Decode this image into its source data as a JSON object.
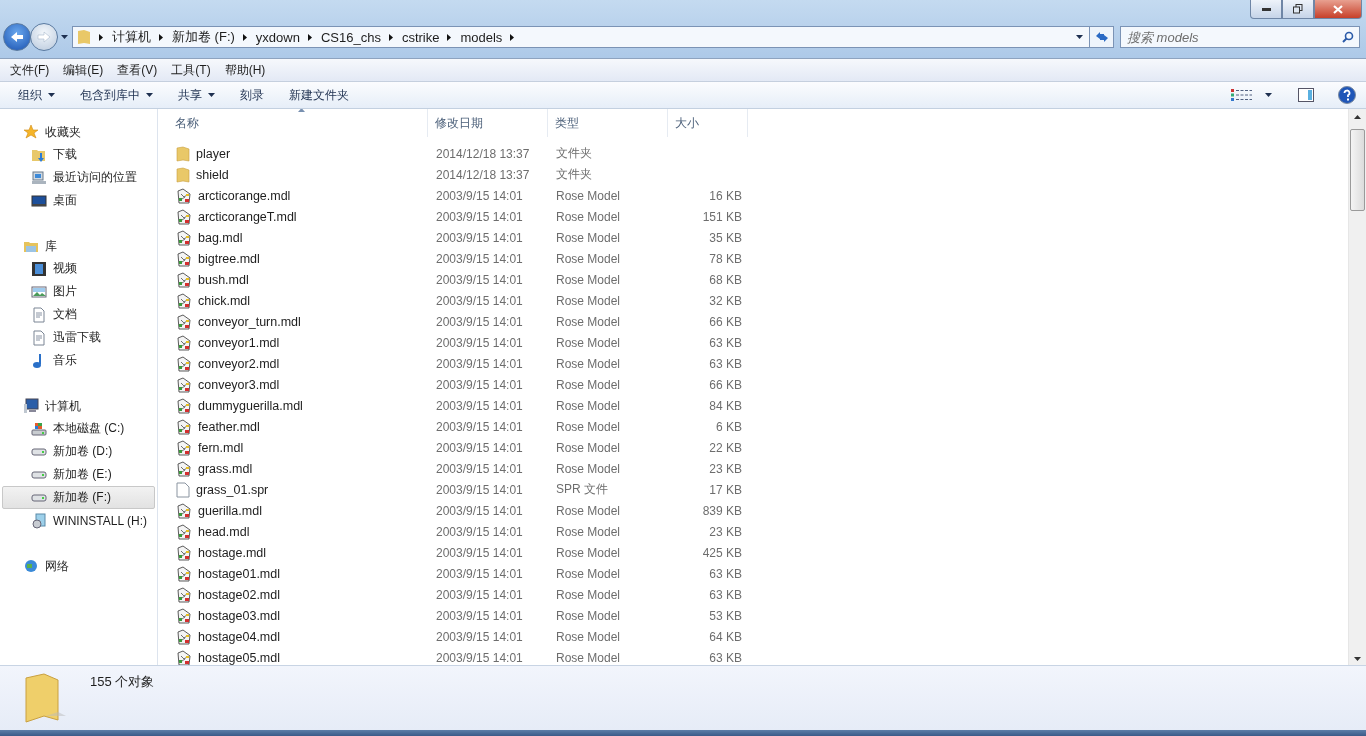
{
  "address": {
    "crumbs": [
      "计算机",
      "新加卷 (F:)",
      "yxdown",
      "CS16_chs",
      "cstrike",
      "models"
    ]
  },
  "search": {
    "placeholder": "搜索 models"
  },
  "menu": [
    "文件(F)",
    "编辑(E)",
    "查看(V)",
    "工具(T)",
    "帮助(H)"
  ],
  "toolbar": [
    {
      "label": "组织",
      "has_menu": true
    },
    {
      "label": "包含到库中",
      "has_menu": true
    },
    {
      "label": "共享",
      "has_menu": true
    },
    {
      "label": "刻录",
      "has_menu": false
    },
    {
      "label": "新建文件夹",
      "has_menu": false
    }
  ],
  "sidebar": [
    {
      "label": "收藏夹",
      "kind": "star",
      "selected": false,
      "children": [
        {
          "label": "下载",
          "kind": "downloads",
          "selected": false
        },
        {
          "label": "最近访问的位置",
          "kind": "recent",
          "selected": false
        },
        {
          "label": "桌面",
          "kind": "desktop",
          "selected": false
        }
      ]
    },
    {
      "label": "库",
      "kind": "library",
      "selected": false,
      "children": [
        {
          "label": "视频",
          "kind": "video",
          "selected": false
        },
        {
          "label": "图片",
          "kind": "picture",
          "selected": false
        },
        {
          "label": "文档",
          "kind": "document",
          "selected": false
        },
        {
          "label": "迅雷下载",
          "kind": "document",
          "selected": false
        },
        {
          "label": "音乐",
          "kind": "music",
          "selected": false
        }
      ]
    },
    {
      "label": "计算机",
      "kind": "computer",
      "selected": false,
      "children": [
        {
          "label": "本地磁盘 (C:)",
          "kind": "systemdrive",
          "selected": false
        },
        {
          "label": "新加卷 (D:)",
          "kind": "drive",
          "selected": false
        },
        {
          "label": "新加卷 (E:)",
          "kind": "drive",
          "selected": false
        },
        {
          "label": "新加卷 (F:)",
          "kind": "drive",
          "selected": true
        },
        {
          "label": "WININSTALL (H:)",
          "kind": "disc",
          "selected": false
        }
      ]
    },
    {
      "label": "网络",
      "kind": "network",
      "selected": false
    }
  ],
  "table": {
    "columns": [
      {
        "label": "名称",
        "sorted": true
      },
      {
        "label": "修改日期",
        "sorted": false
      },
      {
        "label": "类型",
        "sorted": false
      },
      {
        "label": "大小",
        "sorted": false
      }
    ],
    "rows": [
      {
        "kind": "folder",
        "name": "player",
        "date": "2014/12/18 13:37",
        "type": "文件夹"
      },
      {
        "kind": "folder",
        "name": "shield",
        "date": "2014/12/18 13:37",
        "type": "文件夹"
      },
      {
        "kind": "model",
        "name": "arcticorange.mdl",
        "date": "2003/9/15 14:01",
        "type": "Rose Model",
        "size": "16 KB"
      },
      {
        "kind": "model",
        "name": "arcticorangeT.mdl",
        "date": "2003/9/15 14:01",
        "type": "Rose Model",
        "size": "151 KB"
      },
      {
        "kind": "model",
        "name": "bag.mdl",
        "date": "2003/9/15 14:01",
        "type": "Rose Model",
        "size": "35 KB"
      },
      {
        "kind": "model",
        "name": "bigtree.mdl",
        "date": "2003/9/15 14:01",
        "type": "Rose Model",
        "size": "78 KB"
      },
      {
        "kind": "model",
        "name": "bush.mdl",
        "date": "2003/9/15 14:01",
        "type": "Rose Model",
        "size": "68 KB"
      },
      {
        "kind": "model",
        "name": "chick.mdl",
        "date": "2003/9/15 14:01",
        "type": "Rose Model",
        "size": "32 KB"
      },
      {
        "kind": "model",
        "name": "conveyor_turn.mdl",
        "date": "2003/9/15 14:01",
        "type": "Rose Model",
        "size": "66 KB"
      },
      {
        "kind": "model",
        "name": "conveyor1.mdl",
        "date": "2003/9/15 14:01",
        "type": "Rose Model",
        "size": "63 KB"
      },
      {
        "kind": "model",
        "name": "conveyor2.mdl",
        "date": "2003/9/15 14:01",
        "type": "Rose Model",
        "size": "63 KB"
      },
      {
        "kind": "model",
        "name": "conveyor3.mdl",
        "date": "2003/9/15 14:01",
        "type": "Rose Model",
        "size": "66 KB"
      },
      {
        "kind": "model",
        "name": "dummyguerilla.mdl",
        "date": "2003/9/15 14:01",
        "type": "Rose Model",
        "size": "84 KB"
      },
      {
        "kind": "model",
        "name": "feather.mdl",
        "date": "2003/9/15 14:01",
        "type": "Rose Model",
        "size": "6 KB"
      },
      {
        "kind": "model",
        "name": "fern.mdl",
        "date": "2003/9/15 14:01",
        "type": "Rose Model",
        "size": "22 KB"
      },
      {
        "kind": "model",
        "name": "grass.mdl",
        "date": "2003/9/15 14:01",
        "type": "Rose Model",
        "size": "23 KB"
      },
      {
        "kind": "file",
        "name": "grass_01.spr",
        "date": "2003/9/15 14:01",
        "type": "SPR 文件",
        "size": "17 KB"
      },
      {
        "kind": "model",
        "name": "guerilla.mdl",
        "date": "2003/9/15 14:01",
        "type": "Rose Model",
        "size": "839 KB"
      },
      {
        "kind": "model",
        "name": "head.mdl",
        "date": "2003/9/15 14:01",
        "type": "Rose Model",
        "size": "23 KB"
      },
      {
        "kind": "model",
        "name": "hostage.mdl",
        "date": "2003/9/15 14:01",
        "type": "Rose Model",
        "size": "425 KB"
      },
      {
        "kind": "model",
        "name": "hostage01.mdl",
        "date": "2003/9/15 14:01",
        "type": "Rose Model",
        "size": "63 KB"
      },
      {
        "kind": "model",
        "name": "hostage02.mdl",
        "date": "2003/9/15 14:01",
        "type": "Rose Model",
        "size": "63 KB"
      },
      {
        "kind": "model",
        "name": "hostage03.mdl",
        "date": "2003/9/15 14:01",
        "type": "Rose Model",
        "size": "53 KB"
      },
      {
        "kind": "model",
        "name": "hostage04.mdl",
        "date": "2003/9/15 14:01",
        "type": "Rose Model",
        "size": "64 KB"
      },
      {
        "kind": "model",
        "name": "hostage05.mdl",
        "date": "2003/9/15 14:01",
        "type": "Rose Model",
        "size": "63 KB"
      }
    ]
  },
  "status": {
    "count": "155 个对象"
  }
}
